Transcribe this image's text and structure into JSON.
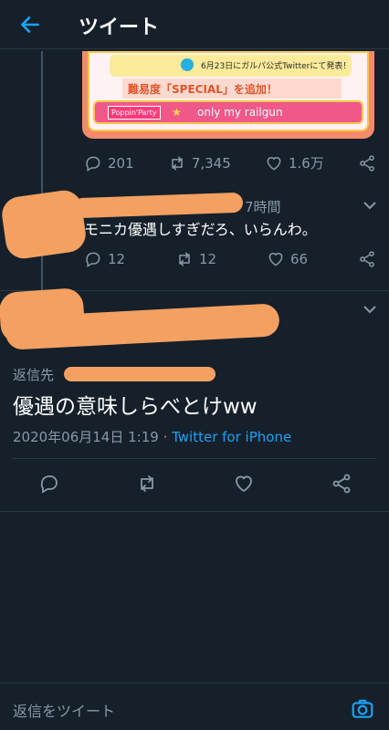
{
  "header": {
    "title": "ツイート"
  },
  "quoted_card": {
    "announce": "6月23日にガルパ公式Twitterにて発表！",
    "difficulty": "難易度「SPECIAL」を追加！",
    "band": "Poppin'Party",
    "song": "only my railgun"
  },
  "parent_stats": {
    "replies": "201",
    "retweets": "7,345",
    "likes": "1.6万"
  },
  "reply": {
    "time": "7時間",
    "text": "モニカ優遇しすぎだろ、いらんわ。",
    "replies": "12",
    "retweets": "12",
    "likes": "66"
  },
  "main_tweet": {
    "reply_to_label": "返信先",
    "text": "優遇の意味しらべとけww",
    "timestamp": "2020年06月14日 1:19 · ",
    "source": "Twitter for iPhone"
  },
  "composer": {
    "placeholder": "返信をツイート"
  },
  "colors": {
    "background": "#15202b",
    "accent": "#1da1f2",
    "muted": "#8899a6",
    "redaction": "#f3a061"
  }
}
